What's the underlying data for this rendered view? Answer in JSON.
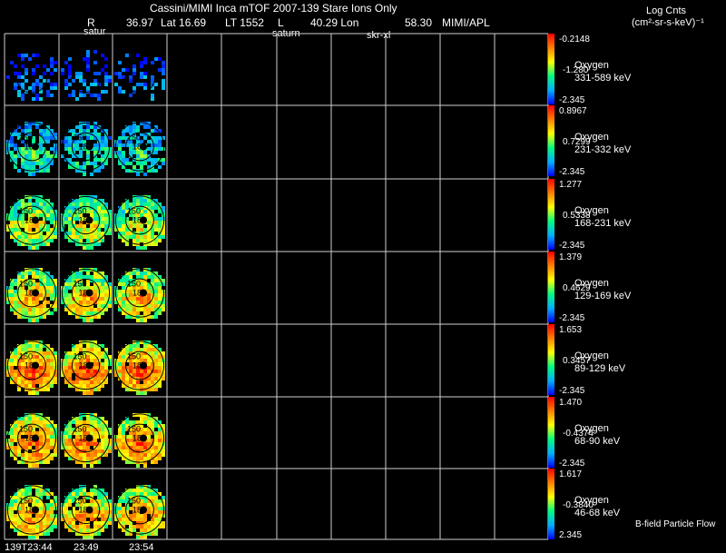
{
  "header": {
    "title": "Cassini/MIMI Inca mTOF  2007-139   Stare    Ions Only",
    "ephem_r_label": "R",
    "ephem_r": "36.97",
    "ephem_lat": "Lat 16.69",
    "ephem_lt": "LT 1552",
    "ephem_l": "L",
    "ephem_lon": "40.29 Lon",
    "ephem_val": "58.30",
    "ephem_src": "MIMI/APL"
  },
  "units": {
    "line1": "Log Cnts",
    "line2": "(cm²-sr-s-keV)⁻¹"
  },
  "column_labels": [
    "satur",
    "saturn",
    "skr-xl"
  ],
  "time_labels": [
    "139T23:44",
    "23:49",
    "23:54"
  ],
  "panels": [
    {
      "species": "Oxygen",
      "energy": "331-589 keV",
      "max": "-0.2148",
      "mid": "-1.280",
      "min": "-2.345"
    },
    {
      "species": "Oxygen",
      "energy": "231-332 keV",
      "max": "0.8967",
      "mid": "0.7299",
      "min": "-2.345"
    },
    {
      "species": "Oxygen",
      "energy": "168-231 keV",
      "max": "1.277",
      "mid": "0.5338",
      "min": "-2.345"
    },
    {
      "species": "Oxygen",
      "energy": "129-169 keV",
      "max": "1.379",
      "mid": "0.4629",
      "min": "-2.345"
    },
    {
      "species": "Oxygen",
      "energy": "89-129 keV",
      "max": "1.653",
      "mid": "0.3457",
      "min": "-2.345"
    },
    {
      "species": "Oxygen",
      "energy": "68-90 keV",
      "max": "1.470",
      "mid": "-0.4374",
      "min": "-2.345"
    },
    {
      "species": "Oxygen",
      "energy": "46-68 keV",
      "max": "1.617",
      "mid": "-0.3840",
      "min": "2.345"
    }
  ],
  "image_labels": {
    "contour_outer": "150",
    "contour_inner": "180",
    "contour_top": "120"
  },
  "footer": {
    "flow_label": "B-field Particle Flow"
  }
}
